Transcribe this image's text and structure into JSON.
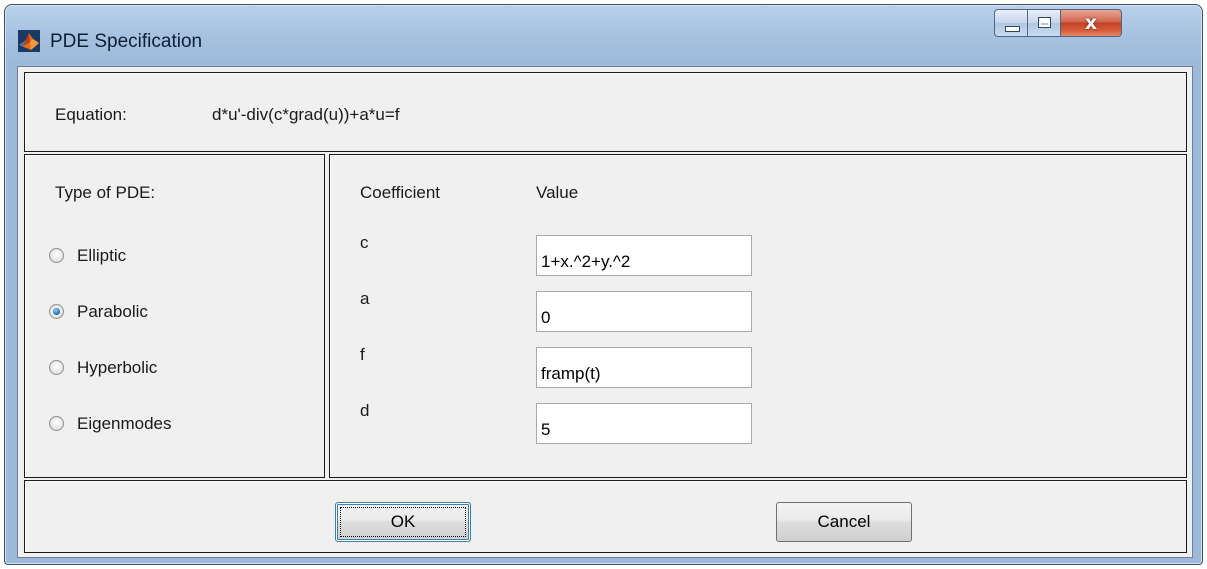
{
  "window": {
    "title": "PDE Specification",
    "icon": "matlab-membrane-icon",
    "close_glyph": "x"
  },
  "equation": {
    "label": "Equation:",
    "text": "d*u'-div(c*grad(u))+a*u=f"
  },
  "pde_type": {
    "heading": "Type of PDE:",
    "options": [
      {
        "label": "Elliptic",
        "selected": false
      },
      {
        "label": "Parabolic",
        "selected": true
      },
      {
        "label": "Hyperbolic",
        "selected": false
      },
      {
        "label": "Eigenmodes",
        "selected": false
      }
    ]
  },
  "coefficients": {
    "header_name": "Coefficient",
    "header_value": "Value",
    "rows": [
      {
        "name": "c",
        "value": "1+x.^2+y.^2"
      },
      {
        "name": "a",
        "value": "0"
      },
      {
        "name": "f",
        "value": "framp(t)"
      },
      {
        "name": "d",
        "value": "5"
      }
    ]
  },
  "buttons": {
    "ok": "OK",
    "cancel": "Cancel"
  },
  "colors": {
    "title_bar": "#a7c2e0",
    "close_button": "#c24228",
    "radio_selected": "#1565b5",
    "dialog_background": "#f0f0f0"
  }
}
